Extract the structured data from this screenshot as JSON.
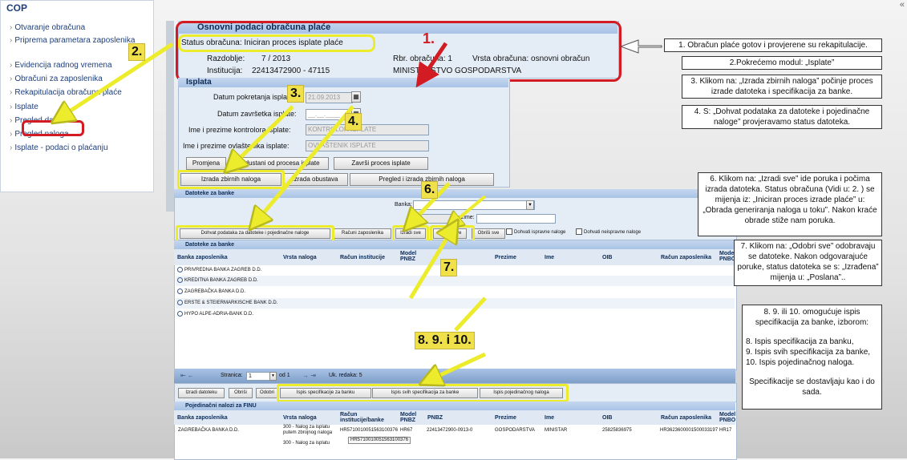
{
  "sidebar": {
    "title": "COP",
    "items": [
      {
        "label": "Otvaranje obračuna"
      },
      {
        "label": "Priprema parametara zaposlenika"
      },
      {
        "label": "Evidencija radnog vremena"
      },
      {
        "label": "Obračuni za zaposlenika"
      },
      {
        "label": "Rekapitulacija obračuna plaće"
      },
      {
        "label": "Isplate"
      },
      {
        "label": "Pregled datoteka"
      },
      {
        "label": "Pregled naloga"
      },
      {
        "label": "Isplate - podaci o plaćanju"
      }
    ]
  },
  "header": {
    "title": "Osnovni podaci obračuna plaće",
    "status": "Status obračuna: Iniciran proces isplate plaće",
    "razdoblje_label": "Razdoblje:",
    "razdoblje_value": "7 / 2013",
    "rbr_label": "Rbr. obračuna: 1",
    "vrsta_label": "Vrsta obračuna: osnovni obračun",
    "institucija_label": "Institucija:",
    "institucija_value": "22413472900 - 47115",
    "ministarstvo": "MINISTARSTVO GOSPODARSTVA"
  },
  "isplata": {
    "title": "Isplata",
    "datum_pokretanja_label": "Datum pokretanja isplate:",
    "datum_pokretanja_value": "21.09.2013",
    "datum_zavrsetka_label": "Datum završetka isplate:",
    "datum_zavrsetka_value": "__.__.____",
    "kontrolor_label": "Ime i prezime kontrolora isplate:",
    "kontrolor_value": "KONTROLOR ISPLATE",
    "ovlastenik_label": "Ime i prezime ovlaštenika isplate:",
    "ovlastenik_value": "OVLAŠTENIK ISPLATE",
    "buttons": {
      "promjena": "Promjena",
      "odustani": "Odustani od procesa isplate",
      "zavrsi": "Završi proces isplate",
      "izrada_zbirnih": "Izrada zbirnih naloga",
      "izrada_obustava": "Izrada obustava",
      "pregled_izrada": "Pregled i izrada zbirnih naloga"
    }
  },
  "datoteke": {
    "title": "Datoteke za banke",
    "banka_label": "Banka:",
    "prezime_label": "Prezime:",
    "buttons": {
      "dohvat": "Dohvat podataka za datoteke i pojedinačne naloge",
      "racuni": "Računi zaposlenika",
      "izradi_sve": "Izradi sve",
      "odobri_sve": "Odobri sve",
      "obrisi_sve": "Obriši sve"
    },
    "check_ispravne": "Dohvati ispravne naloge",
    "check_neispravne": "Dohvati neispravne naloge"
  },
  "banke_table": {
    "title": "Datoteke za banke",
    "columns": [
      "Banka zaposlenika",
      "Vrsta naloga",
      "Račun institucije",
      "Model PNBZ",
      "Prezime",
      "Ime",
      "OIB",
      "Račun zaposlenika",
      "Model PNBO"
    ],
    "rows": [
      "PRIVREDNA BANKA ZAGREB D.D.",
      "KREDITNA BANKA ZAGREB D.D.",
      "ZAGREBAČKA BANKA D.D.",
      "ERSTE & STEIERMARKISCHE BANK D.D.",
      "HYPO ALPE-ADRIA-BANK D.D."
    ]
  },
  "pager": {
    "stranica_label": "Stranica:",
    "page": "1",
    "od_label": "od 1",
    "ukupno_label": "Uk. redaka: 5"
  },
  "bottom_buttons": {
    "izradi_datoteku": "Izradi datoteku",
    "obrisi": "Obriši",
    "odobri": "Odobri",
    "ispis_spec": "Ispis specifikacije za banku",
    "ispis_svih": "Ispis svih specifikacija za banke",
    "ispis_pojed": "Ispis pojedinačnog naloga"
  },
  "finu_table": {
    "title": "Pojedinačni nalozi za FINU",
    "columns": [
      "Banka zaposlenika",
      "Vrsta naloga",
      "Račun institucije/banke",
      "Model PNBZ",
      "PNBZ",
      "Prezime",
      "Ime",
      "OIB",
      "Račun zaposlenika",
      "Model PNBO"
    ],
    "row": {
      "banka": "ZAGREBAČKA BANKA D.D.",
      "vrsta": "300 - Nalog za isplatu putem zbrojnog naloga",
      "vrsta2": "300 - Nalog za isplatu",
      "racun": "HR5710010051563100376",
      "racun2": "HR5710010051563100376",
      "model": "HR67",
      "pnbz": "22413472900-0913-0",
      "prezime": "GOSPODARSTVA",
      "ime": "MINISTAR",
      "oib": "25825836975",
      "racun_zap": "HR3623600001500033197",
      "model_pnbo": "HR17"
    }
  },
  "annotations": {
    "step1": "1.",
    "step2": "2.",
    "step3": "3.",
    "step4": "4.",
    "step6": "6.",
    "step7": "7.",
    "step8": "8. 9. i 10.",
    "note1": "1. Obračun plaće gotov i provjerene su rekapitulacije.",
    "note2": "2.Pokrećemo modul: „Isplate”",
    "note3": "3. Klikom na: „Izrada zbirnih naloga” počinje proces izrade datoteka i specifikacija za banke.",
    "note4": "4. S: „Dohvat podataka za datoteke i pojedinačne naloge” provjeravamo status datoteka.",
    "note6": "6. Klikom na: „Izradi sve” ide poruka i počima izrada datoteka. Status obračuna (Vidi u: 2. ) se mijenja iz: „Iniciran proces izrade plaće” u: „Obrada generiranja naloga u toku”. Nakon kraće obrade stiže nam poruka.",
    "note7": "7. Klikom na: „Odobri sve” odobravaju se datoteke. Nakon odgovarajuće poruke, status datoteka se s: „Izrađena” mijenja u: „Poslana”..",
    "note8_title": "8. 9. ili 10. omogućuje ispis specifikacija za banke, izborom:",
    "note8_a": "8. Ispis specifikacija za banku,",
    "note8_b": "9. Ispis svih specifikacija za banke,",
    "note8_c": "10. Ispis pojedinačnog naloga.",
    "note8_d": "Specifikacije se dostavljaju kao i do sada."
  },
  "colors": {
    "highlight_yellow": "#ecec2c",
    "highlight_red": "#d21b22",
    "panel_blue": "#a9c3e6"
  }
}
